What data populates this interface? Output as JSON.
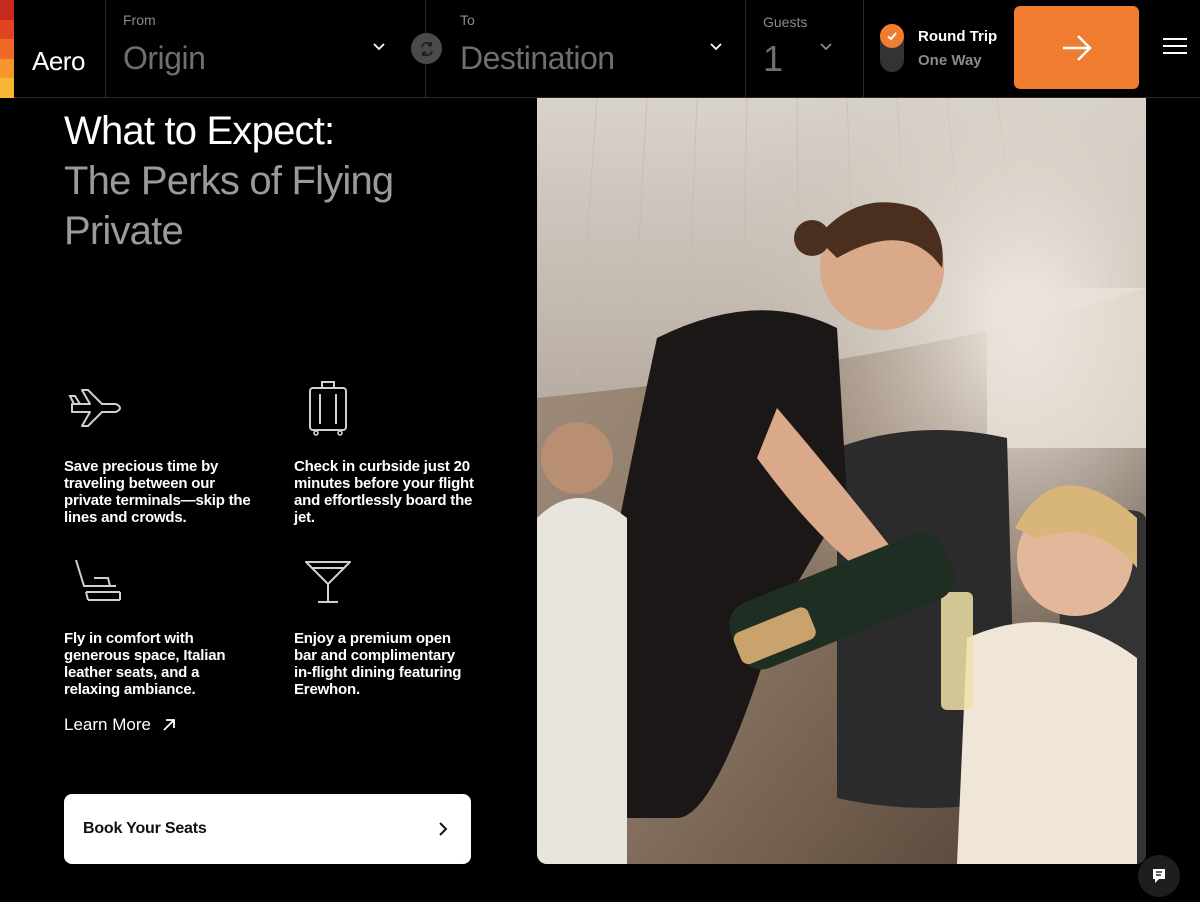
{
  "brand": {
    "name": "Aero",
    "stripe_colors": [
      "#c42a1e",
      "#e0451f",
      "#f06a27",
      "#f5962f",
      "#f7b733"
    ]
  },
  "search": {
    "from_label": "From",
    "from_value": "Origin",
    "to_label": "To",
    "to_value": "Destination",
    "guests_label": "Guests",
    "guests_value": "1",
    "trip_round": "Round Trip",
    "trip_one": "One Way",
    "selected_trip": "Round Trip",
    "accent": "#f07c30"
  },
  "hero": {
    "title_line1": "What to Expect:",
    "title_line2": "The Perks of Flying Private"
  },
  "features": [
    {
      "icon": "plane-icon",
      "text": "Save precious time by traveling between our private terminals—skip the lines and crowds."
    },
    {
      "icon": "luggage-icon",
      "text": "Check in curbside just 20 minutes before your flight and effortlessly board the jet."
    },
    {
      "icon": "seat-icon",
      "text": "Fly in comfort with generous space, Italian leather seats, and a relaxing ambiance."
    },
    {
      "icon": "cocktail-icon",
      "text": "Enjoy a premium open bar and complimentary in-flight dining featuring Erewhon."
    }
  ],
  "links": {
    "learn_more": "Learn More",
    "book_seats": "Book Your Seats"
  }
}
